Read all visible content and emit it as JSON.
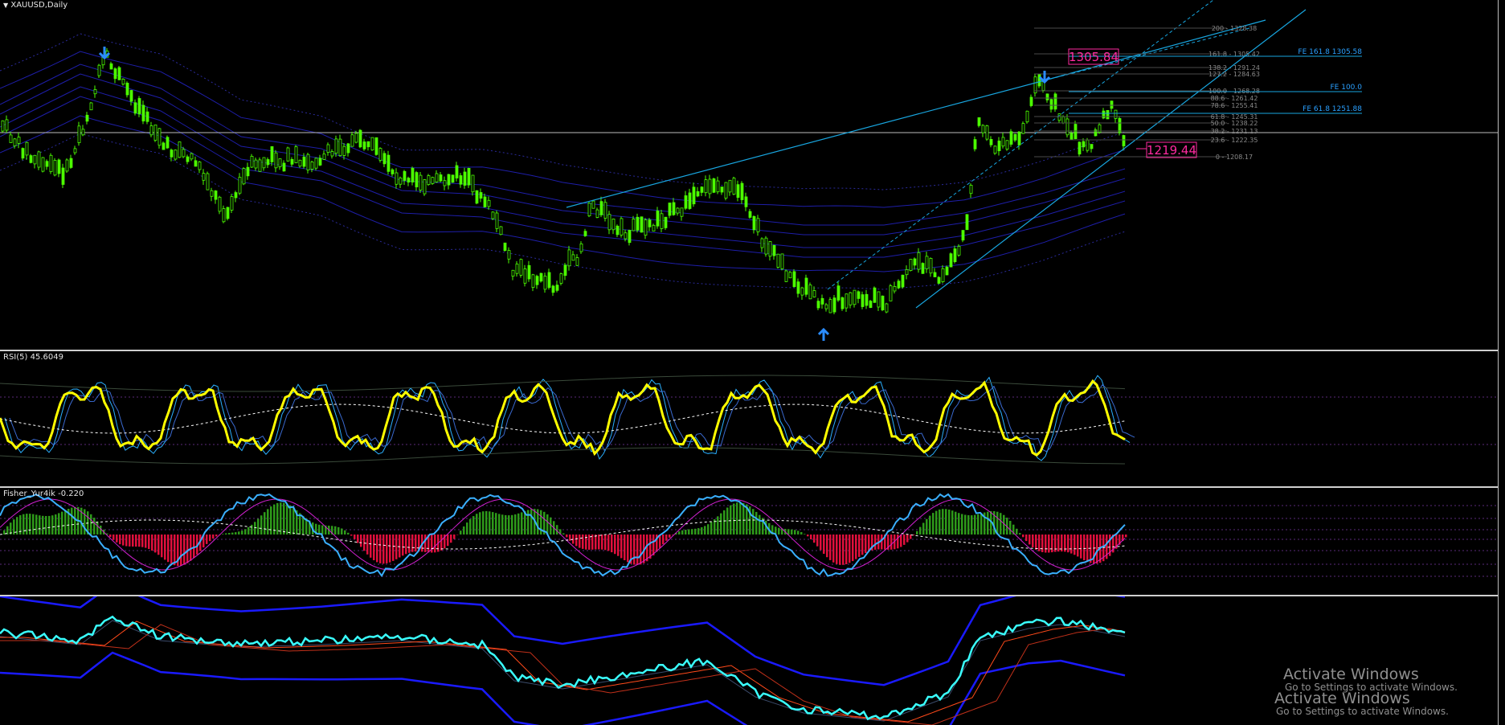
{
  "window": {
    "symbol_title": "XAUUSD,Daily"
  },
  "panes": {
    "main": {
      "label": "XAUUSD,Daily"
    },
    "rsi": {
      "label": "RSI(5) 45.6049"
    },
    "fisher": {
      "label": "Fisher_Yur4ik -0.220"
    },
    "bands": {
      "label": ""
    }
  },
  "fib_levels": [
    "200 - 1328.38",
    "161.8 - 1305.42",
    "138.2 - 1291.24",
    "127.2 - 1284.63",
    "100.0 - 1268.28",
    "88.6 - 1261.42",
    "78.6 - 1255.41",
    "61.8 - 1245.31",
    "50.0 - 1238.22",
    "38.2 - 1231.13",
    "23.6 - 1222.35",
    "0 - 1208.17"
  ],
  "fe_labels": {
    "fe1618": "FE 161.8 1305.58",
    "fe100": "FE 100.0",
    "fe618": "FE 61.8 1251.88"
  },
  "price_tags": {
    "top": "1305.84",
    "current": "1219.44"
  },
  "watermark": {
    "line1_title": "Activate Windows",
    "line1_sub": "Go to Settings to activate Windows.",
    "line2_title": "Activate Windows",
    "line2_sub": "Go to Settings to activate Windows."
  },
  "colors": {
    "candles": "#4cff00",
    "rsi_main": "#ffff00",
    "rsi_signal": "#2ab0ff",
    "fisher_up": "#2e9a1a",
    "fisher_down": "#e0103c",
    "band_line": "#1a1aff",
    "price_tag": "#ff2aa0",
    "trend_line": "#18a6e0"
  }
}
